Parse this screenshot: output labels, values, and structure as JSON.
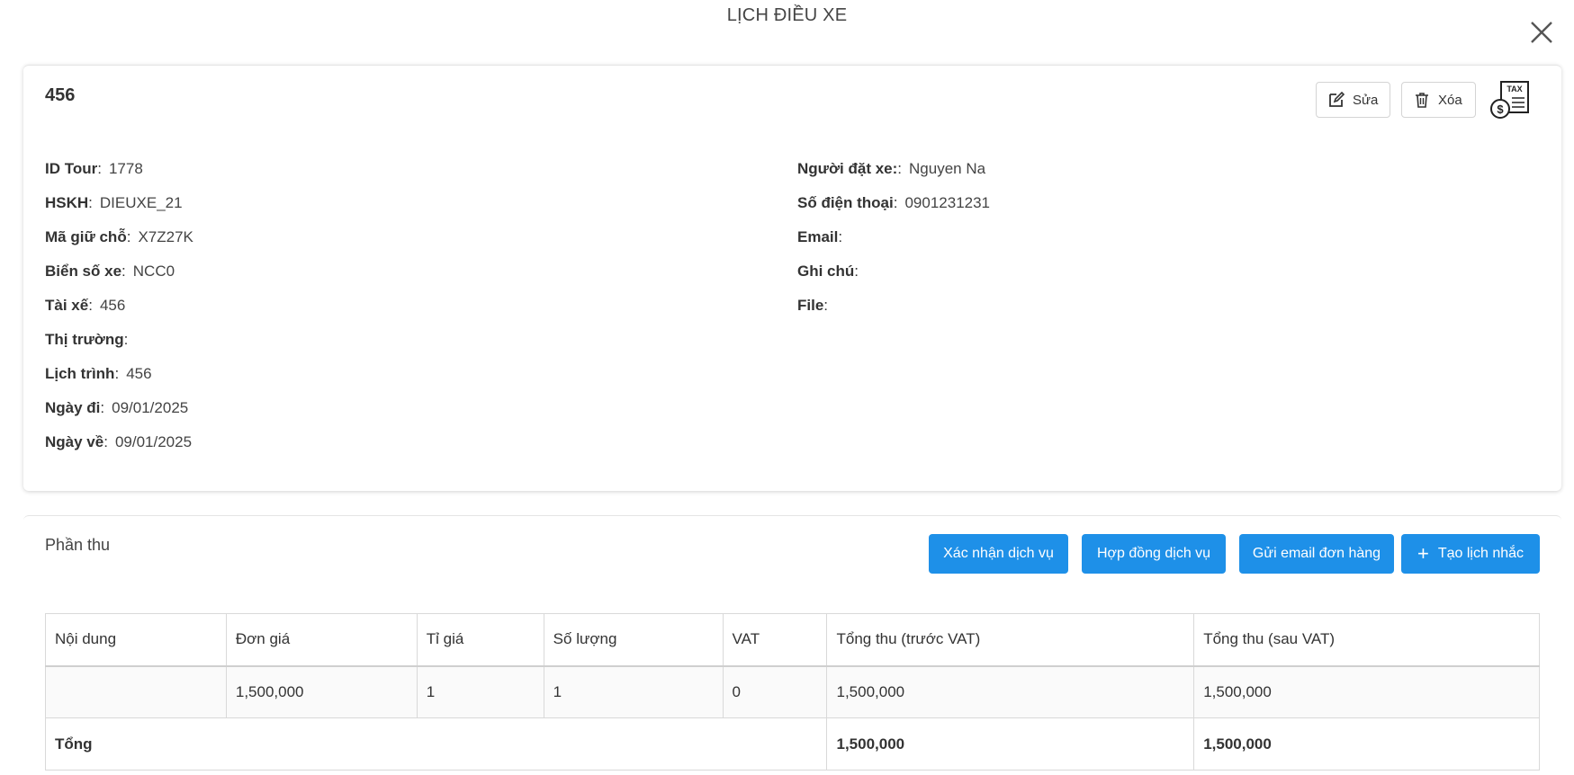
{
  "modal": {
    "title": "LỊCH ĐIỀU XE",
    "close_icon": "close-icon"
  },
  "booking": {
    "name": "456",
    "edit_label": "Sửa",
    "delete_label": "Xóa",
    "tax_icon_text": "TAX",
    "left_fields": [
      {
        "label": "ID Tour",
        "value": "1778"
      },
      {
        "label": "HSKH",
        "value": "DIEUXE_21"
      },
      {
        "label": "Mã giữ chỗ",
        "value": "X7Z27K"
      },
      {
        "label": "Biển số xe",
        "value": "NCC0"
      },
      {
        "label": "Tài xế",
        "value": "456"
      },
      {
        "label": "Thị trường",
        "value": ""
      },
      {
        "label": "Lịch trình",
        "value": "456"
      },
      {
        "label": "Ngày đi",
        "value": "09/01/2025"
      },
      {
        "label": "Ngày về",
        "value": "09/01/2025"
      }
    ],
    "right_fields": [
      {
        "label": "Người đặt xe:",
        "value": "Nguyen Na"
      },
      {
        "label": "Số điện thoại",
        "value": "0901231231"
      },
      {
        "label": "Email",
        "value": ""
      },
      {
        "label": "Ghi chú",
        "value": ""
      },
      {
        "label": "File",
        "value": ""
      }
    ]
  },
  "revenue": {
    "title": "Phần thu",
    "buttons": {
      "confirm": "Xác nhận dịch vụ",
      "contract": "Hợp đồng dịch vụ",
      "email": "Gửi email đơn hàng",
      "reminder": "Tạo lịch nhắc",
      "reminder_plus": "+"
    },
    "table": {
      "headers": [
        "Nội dung",
        "Đơn giá",
        "Tỉ giá",
        "Số lượng",
        "VAT",
        "Tổng thu (trước VAT)",
        "Tổng thu (sau VAT)"
      ],
      "rows": [
        [
          "",
          "1,500,000",
          "1",
          "1",
          "0",
          "1,500,000",
          "1,500,000"
        ]
      ],
      "total": {
        "label": "Tổng",
        "before_vat": "1,500,000",
        "after_vat": "1,500,000"
      }
    }
  },
  "colors": {
    "primary": "#1e90e8"
  }
}
